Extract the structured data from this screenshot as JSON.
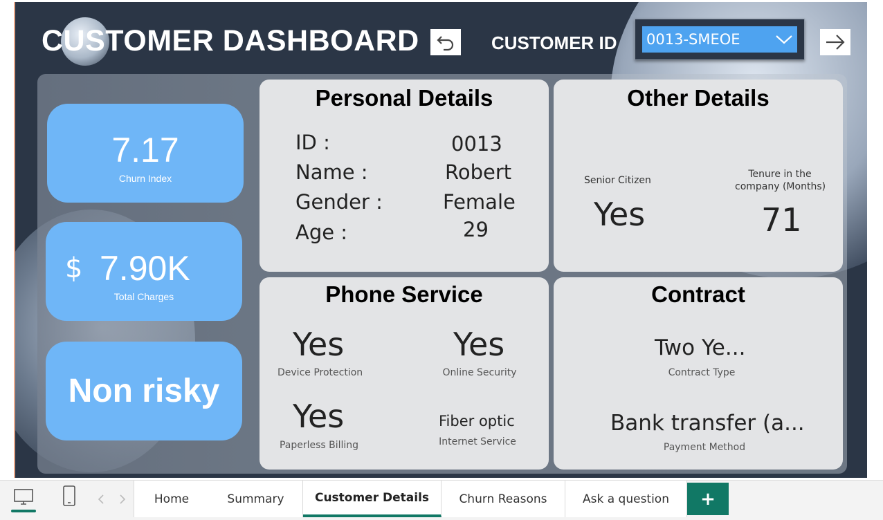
{
  "header": {
    "title": "CUSTOMER DASHBOARD",
    "customer_id_label": "CUSTOMER ID",
    "customer_id_value": "0013-SMEOE"
  },
  "kpis": {
    "churn_index": {
      "value": "7.17",
      "caption": "Churn Index"
    },
    "total_charges": {
      "currency": "$",
      "value": "7.90K",
      "caption": "Total Charges"
    },
    "risk": {
      "value": "Non risky"
    }
  },
  "personal": {
    "title": "Personal Details",
    "id_label": "ID :",
    "id_value": "0013",
    "name_label": "Name :",
    "name_value": "Robert",
    "gender_label": "Gender :",
    "gender_value": "Female",
    "age_label": "Age :",
    "age_value": "29"
  },
  "other": {
    "title": "Other Details",
    "senior_label": "Senior Citizen",
    "senior_value": "Yes",
    "tenure_label_line1": "Tenure in the",
    "tenure_label_line2": "company (Months)",
    "tenure_value": "71"
  },
  "phone": {
    "title": "Phone Service",
    "device_value": "Yes",
    "device_label": "Device Protection",
    "security_value": "Yes",
    "security_label": "Online Security",
    "paperless_value": "Yes",
    "paperless_label": "Paperless Billing",
    "internet_value": "Fiber optic",
    "internet_label": "Internet Service"
  },
  "contract": {
    "title": "Contract",
    "type_value": "Two Ye...",
    "type_label": "Contract Type",
    "payment_value": "Bank transfer (a...",
    "payment_label": "Payment Method"
  },
  "pages": {
    "tabs": [
      "Home",
      "Summary",
      "Customer Details",
      "Churn Reasons",
      "Ask a question"
    ],
    "active": "Customer Details",
    "add_label": "+"
  },
  "colors": {
    "background": "#2b3646",
    "kpi_fill": "#6fb6f7",
    "slicer_fill": "#4ea3f0",
    "active_tab": "#117865"
  }
}
